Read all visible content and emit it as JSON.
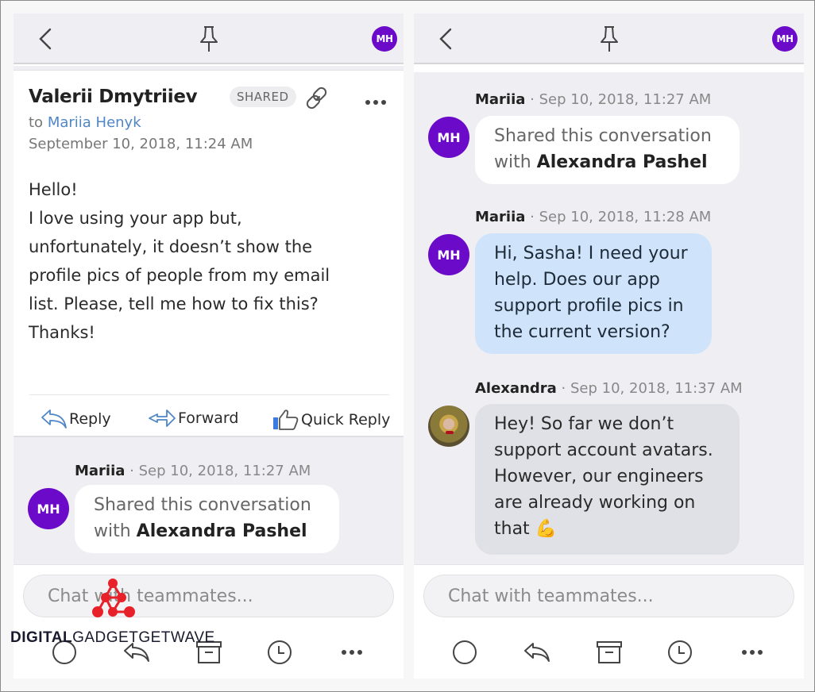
{
  "colors": {
    "accent_purple": "#6b0ac9",
    "link_blue": "#4f86c6",
    "bubble_blue": "#cfe4fb",
    "bubble_grey": "#e0e1e6",
    "watermark_red": "#e8202a"
  },
  "left_panel": {
    "topbar": {
      "back_icon": "chevron-left-icon",
      "pin_icon": "pushpin-icon",
      "avatar_initials": "MH"
    },
    "email": {
      "sender": "Valerii Dmytriiev",
      "badge": "SHARED",
      "to_prefix": "to",
      "to_name": "Mariia Henyk",
      "date": "September 10, 2018, 11:24 AM",
      "body_lines": [
        "Hello!",
        "I love using your app but,",
        "unfortunately, it doesn’t show the",
        "profile pics of people from my email",
        "list. Please, tell me how to fix this?",
        "Thanks!"
      ],
      "actions": {
        "reply": "Reply",
        "forward": "Forward",
        "quick_reply": "Quick Reply"
      }
    },
    "messages": [
      {
        "author": "Mariia",
        "time": "Sep 10, 2018, 11:27 AM",
        "avatar": "MH",
        "line1": "Shared this conversation",
        "line2_prefix": "with ",
        "line2_bold": "Alexandra Pashel"
      }
    ],
    "chat_placeholder": "Chat with teammates..."
  },
  "right_panel": {
    "topbar": {
      "back_icon": "chevron-left-icon",
      "pin_icon": "pushpin-icon",
      "avatar_initials": "MH"
    },
    "messages": [
      {
        "author": "Mariia",
        "time": "Sep 10, 2018, 11:27 AM",
        "avatar": "MH",
        "line1": "Shared this conversation",
        "line2_prefix": "with ",
        "line2_bold": "Alexandra Pashel"
      },
      {
        "author": "Mariia",
        "time": "Sep 10, 2018, 11:28 AM",
        "avatar": "MH",
        "lines": [
          "Hi, Sasha! I need your",
          "help. Does our app",
          "support profile pics in",
          "the current version?"
        ]
      },
      {
        "author": "Alexandra",
        "time": "Sep 10, 2018, 11:37 AM",
        "avatar": "photo",
        "lines": [
          "Hey! So far we don’t",
          "support account avatars.",
          "However, our engineers",
          "are already working on",
          "that 💪"
        ]
      }
    ],
    "chat_placeholder": "Chat with teammates..."
  },
  "toolbar_icons": [
    "circle-icon",
    "reply-icon",
    "archive-icon",
    "clock-icon",
    "more-icon"
  ],
  "separator": "·",
  "watermark": {
    "bold": "DIGITAL",
    "regular": "GADGETGETWAVE"
  }
}
